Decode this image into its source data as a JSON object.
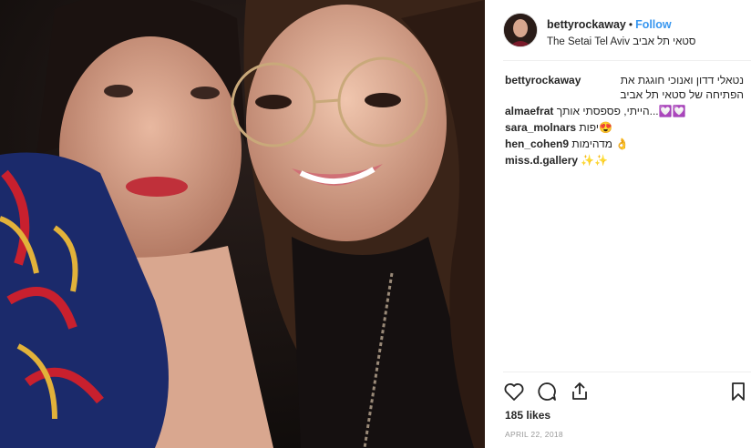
{
  "post": {
    "username": "bettyrockaway",
    "separator": "•",
    "follow_label": "Follow",
    "location": "The Setai Tel Aviv סטאי תל אביב"
  },
  "caption": {
    "username": "bettyrockaway",
    "text": "נטאלי דדון ואנוכי חוגגת את הפתיחה של סטאי תל אביב"
  },
  "comments": [
    {
      "username": "almaefrat",
      "text": "הייתי, פספסתי אותך...💟💟"
    },
    {
      "username": "sara_molnars",
      "text": "יפות😍"
    },
    {
      "username": "hen_cohen9",
      "text": "מדהימות 👌"
    },
    {
      "username": "miss.d.gallery",
      "text": "✨✨"
    }
  ],
  "likes": "185 likes",
  "date": "APRIL 22, 2018",
  "icons": [
    "heart-icon",
    "comment-icon",
    "share-icon",
    "bookmark-icon"
  ],
  "colors": {
    "link": "#3897f0",
    "text": "#262626",
    "muted": "#999999"
  }
}
